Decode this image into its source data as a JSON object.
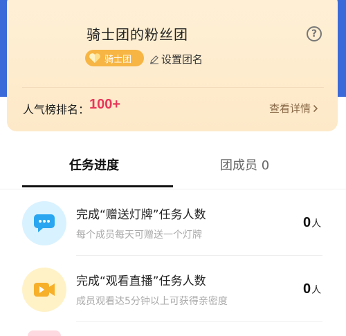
{
  "fan_club": {
    "title": "骑士团的粉丝团",
    "badge_label": "骑士团",
    "edit_name_label": "设置团名",
    "rank_label": "人气榜排名：",
    "rank_value": "100+",
    "detail_label": "查看详情",
    "colors": {
      "rank_value": "#e8365b",
      "badge": "#f7b543"
    }
  },
  "tabs": [
    {
      "label": "任务进度",
      "active": true
    },
    {
      "label": "团成员 0",
      "active": false
    }
  ],
  "tasks": [
    {
      "title": "完成“赠送灯牌”任务人数",
      "description": "每个成员每天可赠送一个灯牌",
      "count": "0",
      "unit": "人",
      "icon": "chat-bubble-icon"
    },
    {
      "title": "完成“观看直播”任务人数",
      "description": "成员观看达5分钟以上可获得亲密度",
      "count": "0",
      "unit": "人",
      "icon": "video-camera-icon"
    }
  ]
}
